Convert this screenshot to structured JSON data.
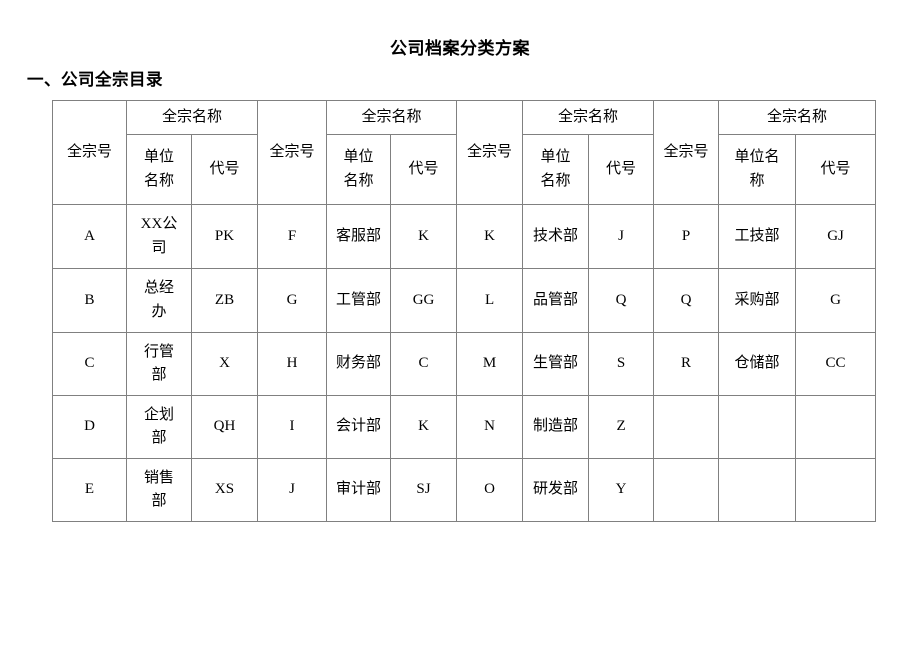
{
  "document": {
    "title": "公司档案分类方案",
    "section_heading": "一、公司全宗目录"
  },
  "table": {
    "headers": {
      "fonds_number": "全宗号",
      "fonds_name": "全宗名称",
      "unit_name": "单位名称",
      "code": "代号"
    },
    "groups": [
      {
        "group_index": 1,
        "rows": [
          {
            "fonds_number": "A",
            "unit_name": "XX公司",
            "code": "PK"
          },
          {
            "fonds_number": "B",
            "unit_name": "总经办",
            "code": "ZB"
          },
          {
            "fonds_number": "C",
            "unit_name": "行管部",
            "code": "X"
          },
          {
            "fonds_number": "D",
            "unit_name": "企划部",
            "code": "QH"
          },
          {
            "fonds_number": "E",
            "unit_name": "销售部",
            "code": "XS"
          }
        ]
      },
      {
        "group_index": 2,
        "rows": [
          {
            "fonds_number": "F",
            "unit_name": "客服部",
            "code": "K"
          },
          {
            "fonds_number": "G",
            "unit_name": "工管部",
            "code": "GG"
          },
          {
            "fonds_number": "H",
            "unit_name": "财务部",
            "code": "C"
          },
          {
            "fonds_number": "I",
            "unit_name": "会计部",
            "code": "K"
          },
          {
            "fonds_number": "J",
            "unit_name": "审计部",
            "code": "SJ"
          }
        ]
      },
      {
        "group_index": 3,
        "rows": [
          {
            "fonds_number": "K",
            "unit_name": "技术部",
            "code": "J"
          },
          {
            "fonds_number": "L",
            "unit_name": "品管部",
            "code": "Q"
          },
          {
            "fonds_number": "M",
            "unit_name": "生管部",
            "code": "S"
          },
          {
            "fonds_number": "N",
            "unit_name": "制造部",
            "code": "Z"
          },
          {
            "fonds_number": "O",
            "unit_name": "研发部",
            "code": "Y"
          }
        ]
      },
      {
        "group_index": 4,
        "rows": [
          {
            "fonds_number": "P",
            "unit_name": "工技部",
            "code": "GJ"
          },
          {
            "fonds_number": "Q",
            "unit_name": "采购部",
            "code": "G"
          },
          {
            "fonds_number": "R",
            "unit_name": "仓储部",
            "code": "CC"
          },
          {
            "fonds_number": "",
            "unit_name": "",
            "code": ""
          },
          {
            "fonds_number": "",
            "unit_name": "",
            "code": ""
          }
        ]
      }
    ]
  },
  "colors": {
    "page_background": "#ffffff",
    "text": "#000000",
    "grid_line": "#808080"
  }
}
